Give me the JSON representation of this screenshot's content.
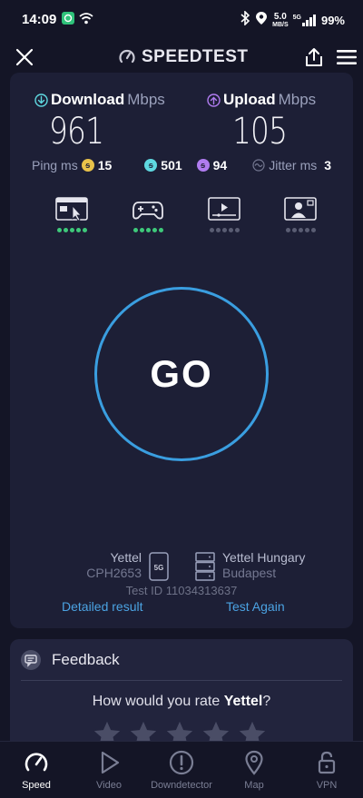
{
  "status_bar": {
    "time": "14:09",
    "net_speed_value": "5.0",
    "net_speed_unit": "MB/S",
    "network": "5G",
    "battery": "99%"
  },
  "header": {
    "brand": "SPEEDTEST"
  },
  "results": {
    "download": {
      "label": "Download",
      "unit": "Mbps",
      "value": "961",
      "color": "#5fd8e0"
    },
    "upload": {
      "label": "Upload",
      "unit": "Mbps",
      "value": "105",
      "color": "#b07cf0"
    },
    "ping": {
      "label": "Ping",
      "unit": "ms",
      "idle": "15",
      "download": "501",
      "upload": "94"
    },
    "jitter": {
      "label": "Jitter",
      "unit": "ms",
      "value": "3"
    }
  },
  "experience_types": [
    {
      "icon": "web-browsing-icon",
      "rating": 5
    },
    {
      "icon": "gaming-icon",
      "rating": 5
    },
    {
      "icon": "video-streaming-icon",
      "rating": 0
    },
    {
      "icon": "video-call-icon",
      "rating": 0
    }
  ],
  "go_button": {
    "label": "GO"
  },
  "connection": {
    "provider": "Yettel",
    "device": "CPH2653",
    "network_badge": "5G",
    "server_name": "Yettel Hungary",
    "server_city": "Budapest",
    "test_id": "Test ID 11034313637",
    "detailed_result_label": "Detailed result",
    "test_again_label": "Test Again"
  },
  "feedback": {
    "title": "Feedback",
    "question_prefix": "How would you rate ",
    "question_brand": "Yettel",
    "question_suffix": "?"
  },
  "bottom_nav": [
    {
      "label": "Speed",
      "icon": "speedometer-icon",
      "active": true
    },
    {
      "label": "Video",
      "icon": "play-icon",
      "active": false
    },
    {
      "label": "Downdetector",
      "icon": "alert-icon",
      "active": false
    },
    {
      "label": "Map",
      "icon": "map-pin-icon",
      "active": false
    },
    {
      "label": "VPN",
      "icon": "lock-icon",
      "active": false
    }
  ],
  "colors": {
    "background": "#141526",
    "card": "#1d1f36",
    "accent_blue": "#3a9ee0",
    "rating_green": "#3ec97a"
  }
}
